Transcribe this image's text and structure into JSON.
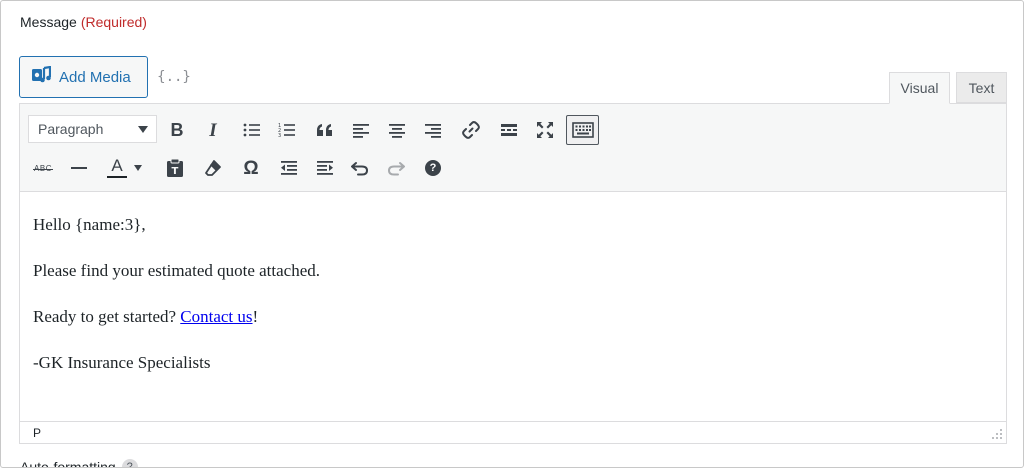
{
  "field": {
    "label": "Message",
    "required": "(Required)"
  },
  "media": {
    "add_label": "Add Media",
    "merge_tag_glyph": "{..}"
  },
  "tabs": [
    {
      "label": "Visual",
      "active": true
    },
    {
      "label": "Text",
      "active": false
    }
  ],
  "toolbar": {
    "format_value": "Paragraph",
    "row1": [
      "bold-icon",
      "italic-icon",
      "bulleted-list-icon",
      "numbered-list-icon",
      "blockquote-icon",
      "align-left-icon",
      "align-center-icon",
      "align-right-icon",
      "link-icon",
      "read-more-icon",
      "fullscreen-icon",
      "toolbar-toggle-icon"
    ],
    "row2": [
      "strikethrough-icon",
      "horizontal-line-icon",
      "text-color-icon",
      "paste-text-icon",
      "clear-formatting-icon",
      "special-character-icon",
      "outdent-icon",
      "indent-icon",
      "undo-icon",
      "redo-icon",
      "help-icon"
    ],
    "strike_text": "ABC",
    "text_color_letter": "A",
    "omega": "Ω",
    "help": "?",
    "bold": "B",
    "italic": "I",
    "quote": "“"
  },
  "content": {
    "line1": "Hello {name:3},",
    "line2": "Please find your estimated quote attached.",
    "line3_prefix": "Ready to get started? ",
    "line3_link": "Contact us",
    "line3_suffix": "!",
    "line4": "-GK Insurance Specialists"
  },
  "status": {
    "path": "p"
  },
  "footer": {
    "autoformat_label": "Auto-formatting",
    "help": "?"
  },
  "colors": {
    "accent": "#2271b1",
    "required": "#c02b2b",
    "link": "#0000ee",
    "text_color_swatch": "#1d2327"
  }
}
